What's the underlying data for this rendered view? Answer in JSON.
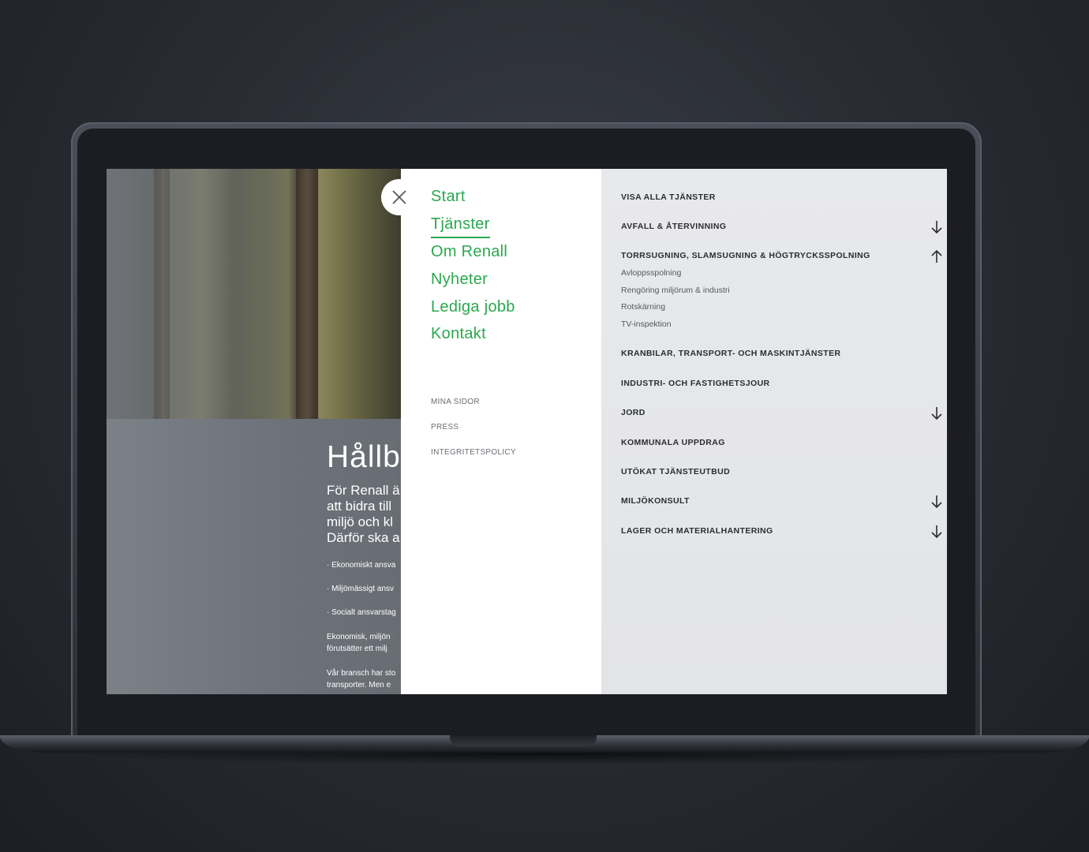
{
  "hero": {
    "title": "Hållb",
    "lead": "För Renall ä\natt bidra till\nmiljö och kl\nDärför ska a",
    "bullets": [
      "· Ekonomiskt ansva",
      "· Miljömässigt ansv",
      "· Socialt ansvarstag"
    ],
    "para1": [
      "Ekonomisk, miljön",
      "förutsätter ett milj"
    ],
    "para2": [
      "Vår bransch har sto",
      "transporter. Men e"
    ]
  },
  "close": {
    "icon": "close-icon"
  },
  "nav": {
    "items": [
      "Start",
      "Tjänster",
      "Om Renall",
      "Nyheter",
      "Lediga jobb",
      "Kontakt"
    ],
    "active": "Tjänster",
    "secondary": [
      "MINA SIDOR",
      "PRESS",
      "INTEGRITETSPOLICY"
    ]
  },
  "services": {
    "items": [
      {
        "label": "VISA ALLA TJÄNSTER",
        "arrow": ""
      },
      {
        "label": "AVFALL & ÅTERVINNING",
        "arrow": "arrow-down-icon"
      },
      {
        "label": "TORRSUGNING, SLAMSUGNING & HÖGTRYCKSSPOLNING",
        "arrow": "arrow-up-icon",
        "children": [
          "Avloppsspolning",
          "Rengöring miljörum & industri",
          "Rotskärning",
          "TV-inspektion"
        ]
      },
      {
        "label": "KRANBILAR, TRANSPORT- OCH MASKINTJÄNSTER",
        "arrow": ""
      },
      {
        "label": "INDUSTRI- OCH FASTIGHETSJOUR",
        "arrow": ""
      },
      {
        "label": "JORD",
        "arrow": "arrow-down-icon"
      },
      {
        "label": "KOMMUNALA UPPDRAG",
        "arrow": ""
      },
      {
        "label": "UTÖKAT TJÄNSTEUTBUD",
        "arrow": ""
      },
      {
        "label": "MILJÖKONSULT",
        "arrow": "arrow-down-icon"
      },
      {
        "label": "LAGER OCH MATERIALHANTERING",
        "arrow": "arrow-down-icon"
      }
    ]
  },
  "colors": {
    "accent": "#2aa84f",
    "panel": "#e6e7ea",
    "text_dark": "#2b2d31"
  }
}
